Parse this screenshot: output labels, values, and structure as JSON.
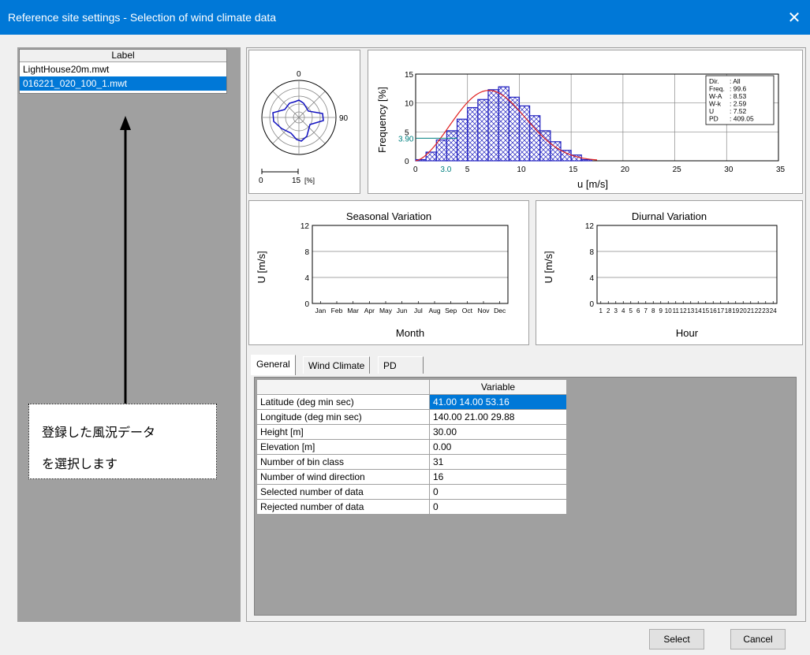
{
  "window": {
    "title": "Reference site settings - Selection of wind climate data",
    "close_icon": "close-icon"
  },
  "list": {
    "header": "Label",
    "items": [
      {
        "label": "LightHouse20m.mwt",
        "selected": false
      },
      {
        "label": "016221_020_100_1.mwt",
        "selected": true
      }
    ]
  },
  "callout": {
    "line1": "登録した風況データ",
    "line2": "を選択します"
  },
  "rose": {
    "north": "0",
    "east": "90",
    "scale_zero": "0",
    "scale_max": "15",
    "scale_unit": "[%]"
  },
  "histogram": {
    "ylabel": "Frequency [%]",
    "xlabel": "u [m/s]",
    "marker_y": "3.90",
    "marker_x": "3.0",
    "stats": [
      {
        "k": "Dir.",
        "v": ": All"
      },
      {
        "k": "Freq.",
        "v": ": 99.6"
      },
      {
        "k": "W-A",
        "v": ": 8.53"
      },
      {
        "k": "W-k",
        "v": ": 2.59"
      },
      {
        "k": "U",
        "v": ": 7.52"
      },
      {
        "k": "PD",
        "v": ": 409.05"
      }
    ]
  },
  "chart_data": [
    {
      "type": "bar",
      "title": "",
      "xlabel": "u [m/s]",
      "ylabel": "Frequency [%]",
      "x": [
        0.5,
        1.5,
        2.5,
        3.5,
        4.5,
        5.5,
        6.5,
        7.5,
        8.5,
        9.5,
        10.5,
        11.5,
        12.5,
        13.5,
        14.5,
        15.5,
        16.5
      ],
      "values": [
        0.2,
        1.5,
        3.6,
        5.2,
        7.2,
        9.2,
        10.6,
        12.3,
        12.8,
        11.0,
        9.5,
        7.8,
        5.2,
        3.3,
        1.8,
        1.0,
        0.2
      ],
      "xticks": [
        "0",
        "5",
        "10",
        "15",
        "20",
        "25",
        "30",
        "35"
      ],
      "yticks": [
        "0",
        "5",
        "10",
        "15"
      ],
      "xlim": [
        0,
        35
      ],
      "ylim": [
        0,
        15
      ]
    },
    {
      "type": "line",
      "title": "Seasonal Variation",
      "xlabel": "Month",
      "ylabel": "U [m/s]",
      "categories": [
        "Jan",
        "Feb",
        "Mar",
        "Apr",
        "May",
        "Jun",
        "Jul",
        "Aug",
        "Sep",
        "Oct",
        "Nov",
        "Dec"
      ],
      "yticks": [
        "0",
        "4",
        "8",
        "12"
      ],
      "ylim": [
        0,
        12
      ],
      "series": []
    },
    {
      "type": "line",
      "title": "Diurnal Variation",
      "xlabel": "Hour",
      "ylabel": "U [m/s]",
      "categories": [
        "1",
        "2",
        "3",
        "4",
        "5",
        "6",
        "7",
        "8",
        "9",
        "10",
        "11",
        "12",
        "13",
        "14",
        "15",
        "16",
        "17",
        "18",
        "19",
        "20",
        "21",
        "22",
        "23",
        "24"
      ],
      "yticks": [
        "0",
        "4",
        "8",
        "12"
      ],
      "ylim": [
        0,
        12
      ],
      "series": []
    }
  ],
  "tabs": {
    "items": [
      "General",
      "Wind Climate",
      "PD"
    ],
    "active": 0
  },
  "table": {
    "header": "Variable",
    "rows": [
      {
        "label": "Latitude (deg min sec)",
        "value": "41.00 14.00 53.16",
        "selected": true
      },
      {
        "label": "Longitude (deg min sec)",
        "value": "140.00 21.00 29.88",
        "selected": false
      },
      {
        "label": "Height [m]",
        "value": "30.00",
        "selected": false
      },
      {
        "label": "Elevation [m]",
        "value": "0.00",
        "selected": false
      },
      {
        "label": "Number of bin class",
        "value": "31",
        "selected": false
      },
      {
        "label": "Number of wind direction",
        "value": "16",
        "selected": false
      },
      {
        "label": "Selected number of data",
        "value": "0",
        "selected": false
      },
      {
        "label": "Rejected number of data",
        "value": "0",
        "selected": false
      }
    ]
  },
  "buttons": {
    "select": "Select",
    "cancel": "Cancel"
  },
  "colors": {
    "accent": "#0078d7",
    "bar": "#2020c0",
    "curve": "#e02020",
    "marker": "#008080"
  }
}
